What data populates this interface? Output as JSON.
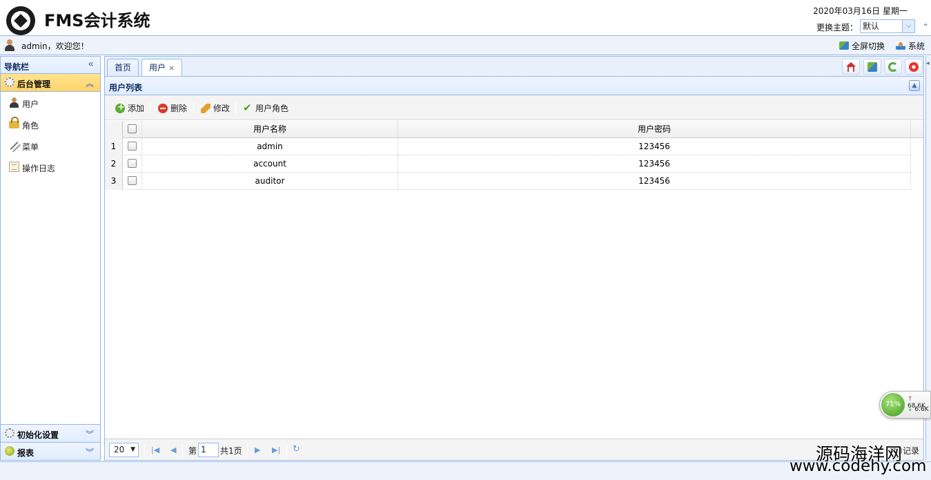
{
  "header": {
    "app_title": "FMS会计系统",
    "date": "2020年03月16日 星期一",
    "theme_label": "更换主题：",
    "theme_value": "默认"
  },
  "userbar": {
    "welcome": "admin，欢迎您！",
    "fullscreen": "全屏切换",
    "system": "系统"
  },
  "sidebar": {
    "title": "导航栏",
    "active_group": "后台管理",
    "items": [
      {
        "label": "用户",
        "icon": "user-icon"
      },
      {
        "label": "角色",
        "icon": "lock-icon"
      },
      {
        "label": "菜单",
        "icon": "menu-icon"
      },
      {
        "label": "操作日志",
        "icon": "log-icon"
      }
    ],
    "bottom_groups": [
      "初始化设置",
      "报表"
    ]
  },
  "tabs": [
    {
      "label": "首页",
      "closable": false
    },
    {
      "label": "用户",
      "closable": true,
      "close": "×"
    }
  ],
  "panel": {
    "title": "用户列表",
    "toolbar": {
      "add": "添加",
      "delete": "删除",
      "edit": "修改",
      "user_role": "用户角色"
    }
  },
  "grid": {
    "columns": [
      "用户名称",
      "用户密码"
    ],
    "rows": [
      {
        "num": "1",
        "name": "admin",
        "password": "123456"
      },
      {
        "num": "2",
        "name": "account",
        "password": "123456"
      },
      {
        "num": "3",
        "name": "auditor",
        "password": "123456"
      }
    ]
  },
  "pager": {
    "page_size": "20",
    "page_prefix": "第",
    "page_value": "1",
    "page_total": "共1页",
    "info": "共3记录"
  },
  "net_widget": {
    "percent": "71%",
    "up": "68.6K",
    "down": "6.6K"
  },
  "watermark": {
    "line1": "源码海洋网",
    "line2": "www.codehy.com"
  },
  "colors": {
    "border": "#95b8e7",
    "active_accordion": "#ffd36b",
    "header_bg": "#e0ecff"
  }
}
